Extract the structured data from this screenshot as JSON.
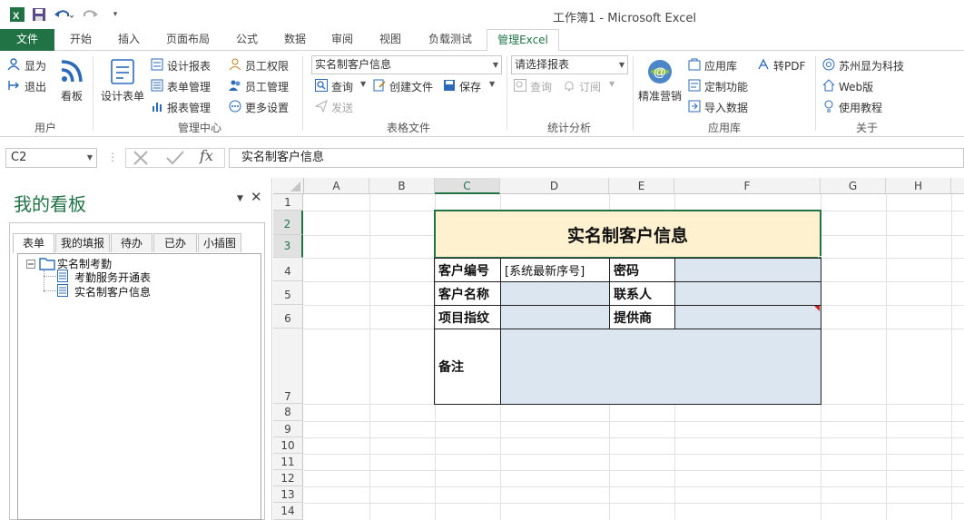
{
  "window": {
    "title": "工作簿1 - Microsoft Excel"
  },
  "tabs": [
    "文件",
    "开始",
    "插入",
    "页面布局",
    "公式",
    "数据",
    "审阅",
    "视图",
    "负载测试",
    "管理Excel"
  ],
  "ribbon": {
    "user": {
      "label": "用户",
      "show": "显为",
      "logout": "退出",
      "board": "看板"
    },
    "manage": {
      "label": "管理中心",
      "design_form": "设计表单",
      "design_report": "设计报表",
      "form_manage": "表单管理",
      "report_manage": "报表管理",
      "emp_perm": "员工权限",
      "emp_manage": "员工管理",
      "more_settings": "更多设置"
    },
    "tablefile": {
      "label": "表格文件",
      "combo_value": "实名制客户信息",
      "query": "查询",
      "create_file": "创建文件",
      "save": "保存",
      "send": "发送"
    },
    "stats": {
      "label": "统计分析",
      "combo_placeholder": "请选择报表",
      "query": "查询",
      "subscribe": "订阅"
    },
    "apps": {
      "label": "应用库",
      "marketing": "精准营销",
      "app_lib": "应用库",
      "custom": "定制功能",
      "import": "导入数据",
      "to_pdf": "转PDF"
    },
    "about": {
      "label": "关于",
      "company": "苏州显为科技",
      "web": "Web版",
      "tutorial": "使用教程"
    }
  },
  "formula_bar": {
    "name_box": "C2",
    "fx": "fx",
    "content": "实名制客户信息"
  },
  "task_pane": {
    "title": "我的看板",
    "tabs": [
      "表单",
      "我的填报",
      "待办",
      "已办",
      "小插图"
    ],
    "tree": {
      "root": "实名制考勤",
      "children": [
        "考勤服务开通表",
        "实名制客户信息"
      ]
    }
  },
  "sheet": {
    "columns": [
      "A",
      "B",
      "C",
      "D",
      "E",
      "F",
      "G",
      "H"
    ],
    "rows": [
      "1",
      "2",
      "3",
      "4",
      "5",
      "6",
      "7",
      "8",
      "9",
      "10",
      "11",
      "12",
      "13",
      "14"
    ],
    "form": {
      "title": "实名制客户信息",
      "customer_no_label": "客户编号",
      "customer_no_value": "[系统最新序号]",
      "password_label": "密码",
      "customer_name_label": "客户名称",
      "contact_label": "联系人",
      "project_label": "项目指纹",
      "supplier_label": "提供商",
      "remark_label": "备注"
    }
  },
  "colors": {
    "excel_green": "#217346",
    "title_fill": "#fdf1d0",
    "field_fill": "#dce6f1"
  }
}
